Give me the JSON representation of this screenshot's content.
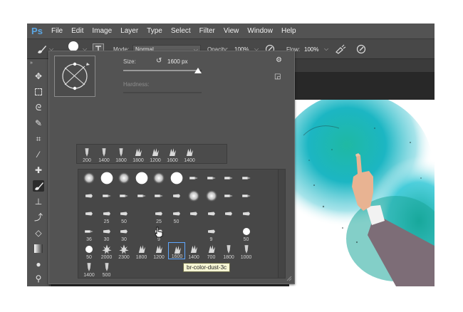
{
  "menubar": {
    "logo": "Ps",
    "items": [
      "File",
      "Edit",
      "Image",
      "Layer",
      "Type",
      "Select",
      "Filter",
      "View",
      "Window",
      "Help"
    ]
  },
  "options": {
    "brush_size": "50",
    "mode_label": "Mode:",
    "mode_value": "Normal",
    "opacity_label": "Opacity:",
    "opacity_value": "100%",
    "flow_label": "Flow:",
    "flow_value": "100%"
  },
  "picker": {
    "size_label": "Size:",
    "size_value": "1600 px",
    "size_fraction": 0.95,
    "hardness_label": "Hardness:",
    "recent_labels": [
      "200",
      "1400",
      "1800",
      "1800",
      "1200",
      "1600",
      "1400"
    ],
    "grid_labels": [
      [
        "",
        "",
        "",
        "",
        "",
        "",
        "",
        "",
        "",
        ""
      ],
      [
        "",
        "",
        "",
        "",
        "",
        "",
        "",
        "",
        "",
        ""
      ],
      [
        "",
        "25",
        "50",
        "",
        "25",
        "50",
        "",
        "",
        "",
        ""
      ],
      [
        "36",
        "30",
        "30",
        "",
        "9",
        "",
        "",
        "9",
        "",
        "50"
      ],
      [
        "50",
        "2000",
        "2300",
        "1800",
        "1200",
        "1600",
        "1400",
        "700",
        "1800",
        "1000"
      ],
      [
        "1400",
        "500",
        "",
        "",
        "",
        "",
        "",
        "",
        "",
        ""
      ]
    ]
  },
  "tooltip": "br-color-dust-3c"
}
